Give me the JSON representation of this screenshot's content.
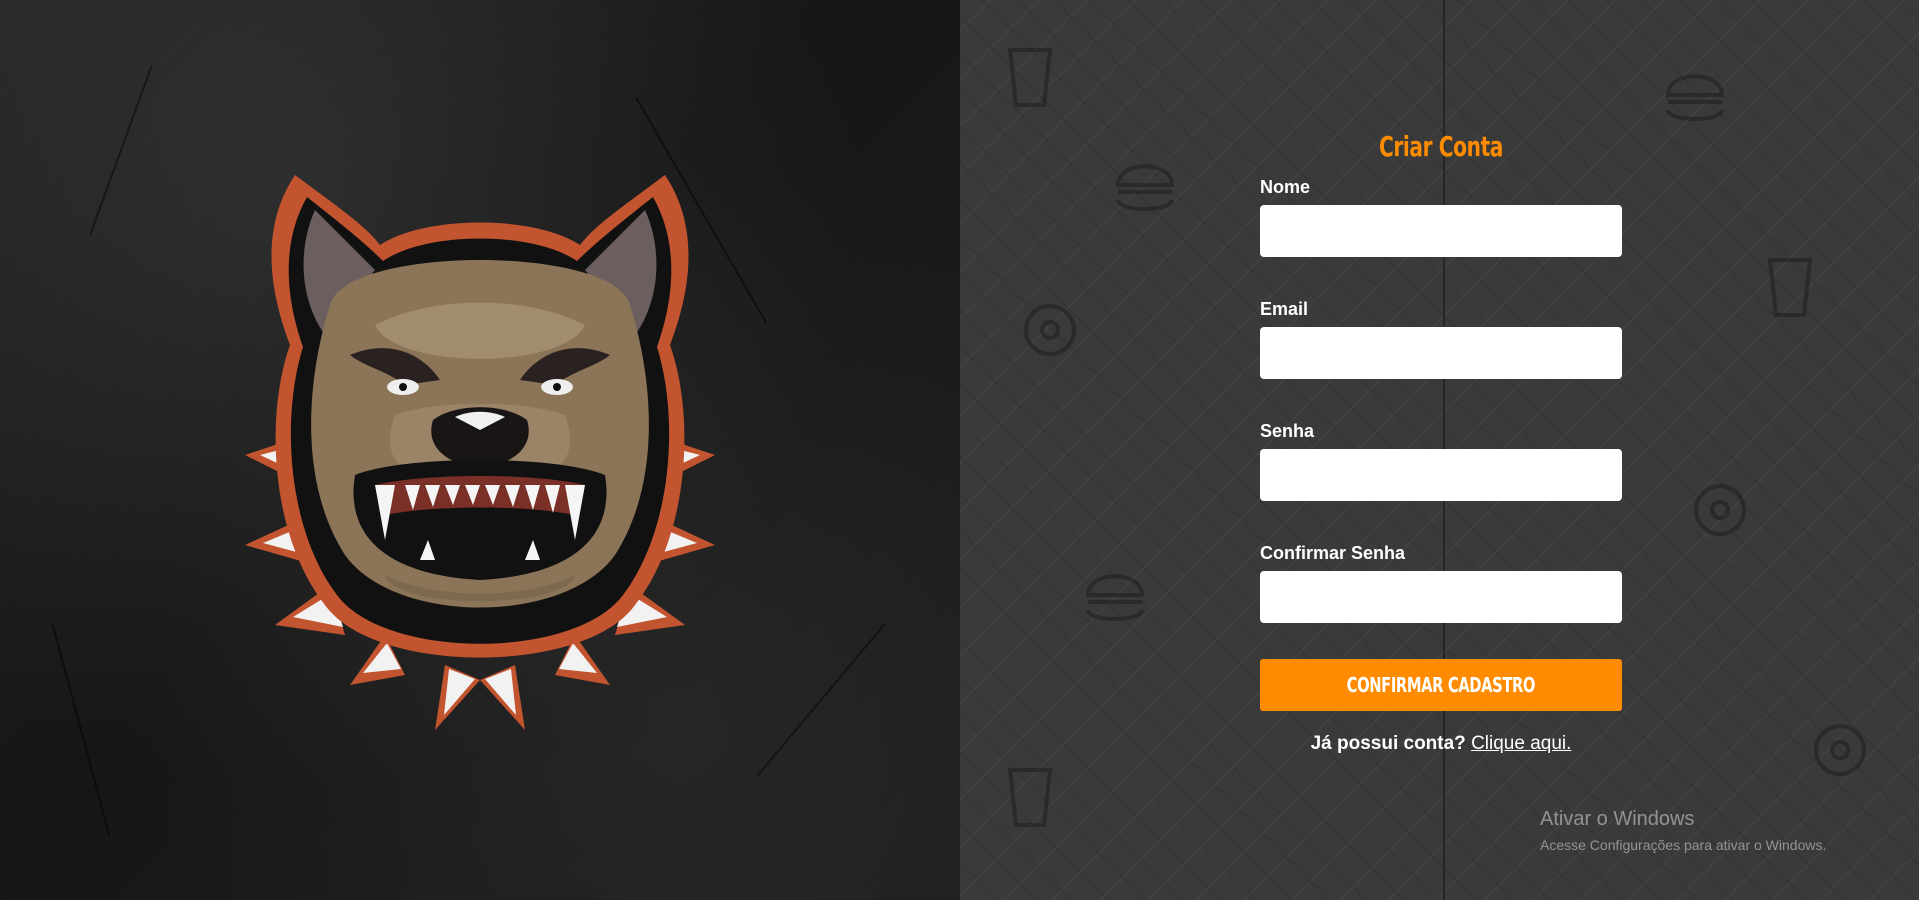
{
  "form": {
    "title": "Criar Conta",
    "fields": [
      {
        "label": "Nome",
        "value": ""
      },
      {
        "label": "Email",
        "value": ""
      },
      {
        "label": "Senha",
        "value": ""
      },
      {
        "label": "Confirmar Senha",
        "value": ""
      }
    ],
    "submit_label": "CONFIRMAR CADASTRO",
    "login_prompt": "Já possui conta?",
    "login_link": "Clique aqui."
  },
  "windows_watermark": {
    "title": "Ativar o Windows",
    "subtitle": "Acesse Configurações para ativar o Windows."
  },
  "colors": {
    "accent": "#ff8c00",
    "left_background": "#1b1b1b",
    "right_background": "#3a3a3a"
  },
  "icons": {
    "mascot": "pitbull-mascot-icon"
  }
}
